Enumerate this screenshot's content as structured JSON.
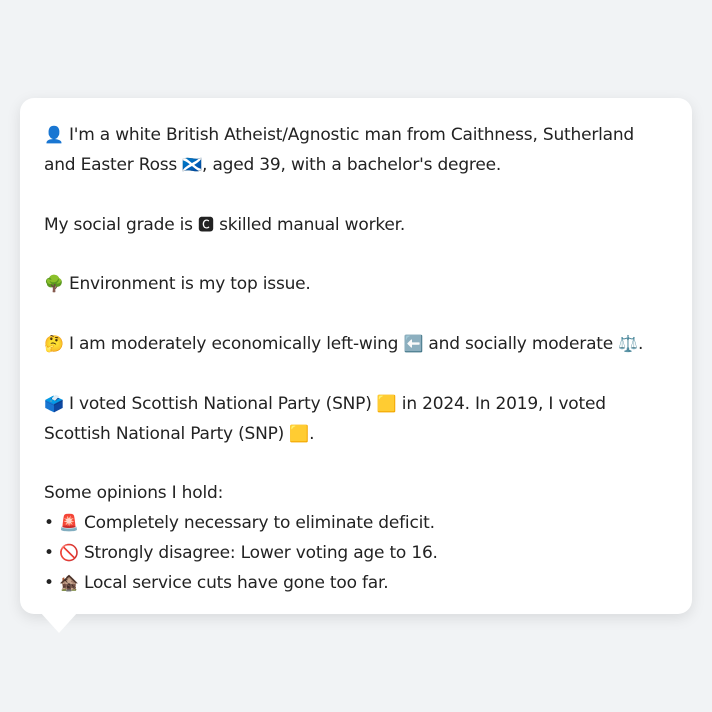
{
  "profile": {
    "line1": {
      "icon": "👤",
      "text_a": " I'm a white British Atheist/Agnostic man from Caithness, Sutherland and Easter Ross ",
      "flag": "🏴󠁧󠁢󠁳󠁣󠁴󠁿",
      "text_b": ", aged 39, with a bachelor's degree."
    },
    "grade": {
      "text_a": "My social grade is ",
      "icon": "🅲",
      "text_b": " skilled manual worker."
    },
    "issue": {
      "icon": "🌳",
      "text": " Environment is my top issue."
    },
    "politics": {
      "icon": "🤔",
      "text_a": " I am moderately economically left-wing ",
      "left_icon": "⬅️",
      "text_b": " and socially moderate ",
      "scale_icon": "⚖️",
      "text_c": "."
    },
    "vote": {
      "icon": "🗳️",
      "text_a": " I voted Scottish National Party (SNP) ",
      "party_icon_1": "🟨",
      "text_b": " in 2024. In 2019, I voted Scottish National Party (SNP) ",
      "party_icon_2": "🟨",
      "text_c": "."
    },
    "opinions": {
      "heading": "Some opinions I hold:",
      "items": [
        {
          "bullet": "• ",
          "icon": "🚨",
          "text": " Completely necessary to eliminate deficit."
        },
        {
          "bullet": "• ",
          "icon": "🚫",
          "text": " Strongly disagree: Lower voting age to 16."
        },
        {
          "bullet": "• ",
          "icon": "🏚️",
          "text": " Local service cuts have gone too far."
        }
      ]
    }
  },
  "colors": {
    "background": "#f1f3f5",
    "bubble": "#ffffff",
    "text": "#222222"
  }
}
